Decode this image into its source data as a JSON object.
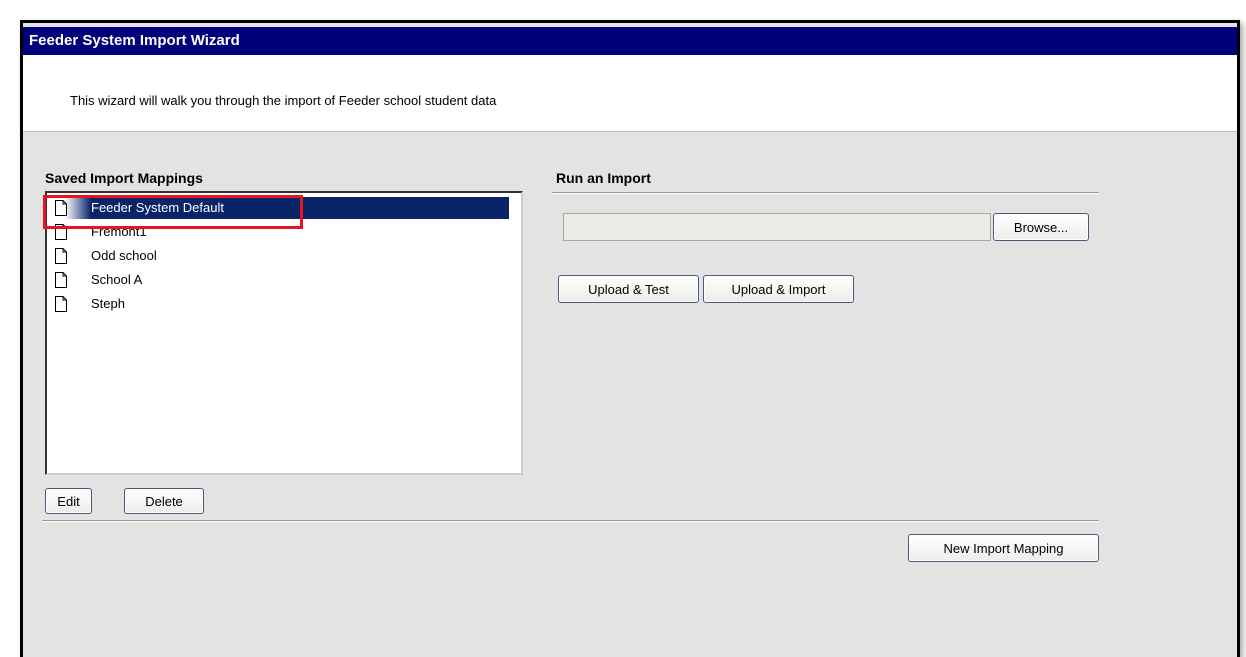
{
  "wizard": {
    "title": "Feeder System Import Wizard",
    "intro": "This wizard will walk you through the import of Feeder school student data"
  },
  "mappings": {
    "heading": "Saved Import Mappings",
    "items": [
      {
        "label": "Feeder System Default",
        "selected": true
      },
      {
        "label": "Fremont1",
        "selected": false
      },
      {
        "label": "Odd school",
        "selected": false
      },
      {
        "label": "School A",
        "selected": false
      },
      {
        "label": "Steph",
        "selected": false
      }
    ],
    "edit_label": "Edit",
    "delete_label": "Delete"
  },
  "run_import": {
    "heading": "Run an Import",
    "file_value": "",
    "browse_label": "Browse...",
    "upload_test_label": "Upload & Test",
    "upload_import_label": "Upload & Import"
  },
  "new_mapping_label": "New Import Mapping",
  "colors": {
    "title_bar": "#00007b",
    "selection": "#0a246a",
    "highlight_box": "#e8141f",
    "panel": "#e3e3e3"
  },
  "icons": {
    "list_item": "document-icon"
  }
}
